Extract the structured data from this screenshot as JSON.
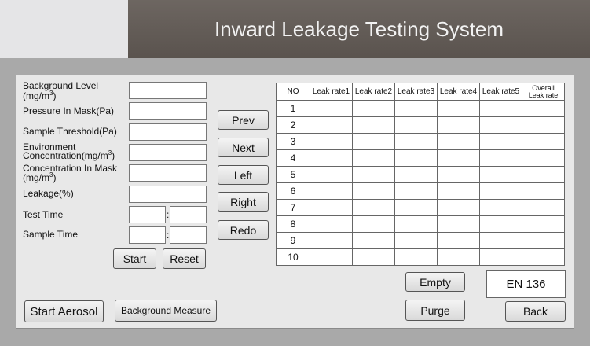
{
  "header": {
    "title": "Inward Leakage Testing System"
  },
  "form": {
    "background_level": {
      "label": "Background Level",
      "unit_main": "(mg/m",
      "unit_sup": "3",
      "unit_end": ")",
      "value": ""
    },
    "pressure_in_mask": {
      "label": "Pressure In Mask(Pa)",
      "value": ""
    },
    "sample_threshold": {
      "label": "Sample Threshold(Pa)",
      "value": ""
    },
    "environment_concentration": {
      "label": "Environment",
      "label2_main": "Concentration(mg/m",
      "label2_sup": "3",
      "label2_end": ")",
      "value": ""
    },
    "concentration_in_mask": {
      "label": "Concentration In Mask",
      "unit_main": "(mg/m",
      "unit_sup": "3",
      "unit_end": ")",
      "value": ""
    },
    "leakage": {
      "label": "Leakage(%)",
      "value": ""
    },
    "test_time": {
      "label": "Test Time",
      "value_a": "",
      "value_b": "",
      "separator": ":"
    },
    "sample_time": {
      "label": "Sample Time",
      "value_a": "",
      "value_b": "",
      "separator": ":"
    }
  },
  "buttons": {
    "start": "Start",
    "reset": "Reset",
    "prev": "Prev",
    "next": "Next",
    "left": "Left",
    "right": "Right",
    "redo": "Redo",
    "start_aerosol": "Start Aerosol",
    "background_measure": "Background Measure",
    "empty": "Empty",
    "purge": "Purge",
    "back": "Back"
  },
  "table": {
    "headers": [
      "NO",
      "Leak rate1",
      "Leak rate2",
      "Leak rate3",
      "Leak rate4",
      "Leak rate5",
      "Overall",
      "Leak rate"
    ],
    "rows": [
      {
        "no": "1"
      },
      {
        "no": "2"
      },
      {
        "no": "3"
      },
      {
        "no": "4"
      },
      {
        "no": "5"
      },
      {
        "no": "6"
      },
      {
        "no": "7"
      },
      {
        "no": "8"
      },
      {
        "no": "9"
      },
      {
        "no": "10"
      }
    ]
  },
  "standard": "EN 136"
}
